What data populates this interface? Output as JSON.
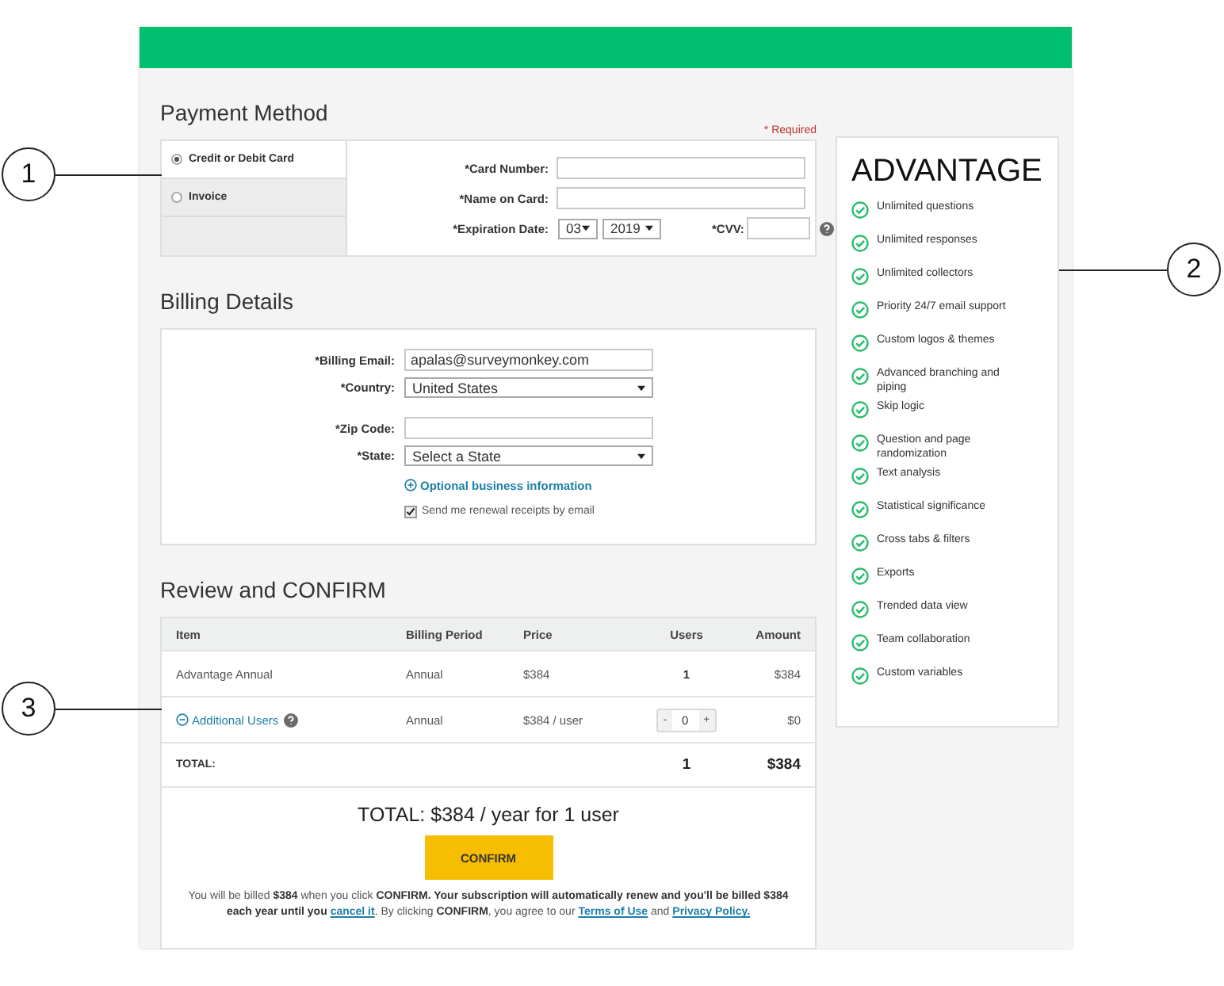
{
  "payment": {
    "title": "Payment Method",
    "required_note": "* Required",
    "methods": [
      {
        "label": "Credit or Debit Card",
        "selected": true
      },
      {
        "label": "Invoice",
        "selected": false
      }
    ],
    "card_number": {
      "label": "*Card Number:"
    },
    "name_on_card": {
      "label": "*Name on Card:"
    },
    "expiration": {
      "label": "*Expiration Date:",
      "month": "03",
      "year": "2019"
    },
    "cvv": {
      "label": "*CVV:"
    }
  },
  "billing": {
    "title": "Billing Details",
    "fields": [
      {
        "kind": "input",
        "label": "*Billing Email:",
        "value": "apalas@surveymonkey.com"
      },
      {
        "kind": "select",
        "label": "*Country:",
        "value": "United States"
      },
      {
        "kind": "input",
        "label": "*Zip Code:"
      },
      {
        "kind": "select",
        "label": "*State:",
        "value": "Select a State"
      }
    ],
    "optional_link": "Optional business information",
    "receipts": {
      "label": "Send me renewal receipts by email",
      "checked": true
    }
  },
  "review": {
    "title": "Review and CONFIRM",
    "columns": [
      "Item",
      "Billing Period",
      "Price",
      "Users",
      "Amount"
    ],
    "rows": [
      {
        "kind": "plain",
        "item": "Advantage Annual",
        "period": "Annual",
        "price": "$384",
        "users": "1",
        "amount": "$384"
      },
      {
        "kind": "stepper",
        "item": "Additional Users",
        "period": "Annual",
        "price": "$384 / user",
        "minus": "-",
        "users": "0",
        "plus": "+",
        "amount": "$0"
      }
    ],
    "total": {
      "label": "TOTAL:",
      "users": "1",
      "amount": "$384"
    },
    "summary": "TOTAL: $384 / year for 1 user",
    "confirm": "CONFIRM",
    "legal": [
      {
        "kind": "text",
        "text": "You will be billed **$384** when you click **CONFIRM. Your subscription will automatically renew and you'll be billed $384 each year until you** "
      },
      {
        "kind": "link",
        "text": "cancel it"
      },
      {
        "kind": "text",
        "text": ". By clicking **CONFIRM**, you agree to our "
      },
      {
        "kind": "link",
        "text": "Terms of Use"
      },
      {
        "kind": "text",
        "text": " and "
      },
      {
        "kind": "link",
        "text": "Privacy Policy."
      }
    ]
  },
  "plan": {
    "title": "ADVANTAGE",
    "features": [
      "Unlimited questions",
      "Unlimited responses",
      "Unlimited collectors",
      "Priority 24/7 email support",
      "Custom logos & themes",
      "Advanced branching and piping",
      "Skip logic",
      "Question and page randomization",
      "Text analysis",
      "Statistical significance",
      "Cross tabs & filters",
      "Exports",
      "Trended data view",
      "Team collaboration",
      "Custom variables"
    ]
  },
  "callouts": [
    {
      "number": "1"
    },
    {
      "number": "2"
    },
    {
      "number": "3"
    }
  ]
}
